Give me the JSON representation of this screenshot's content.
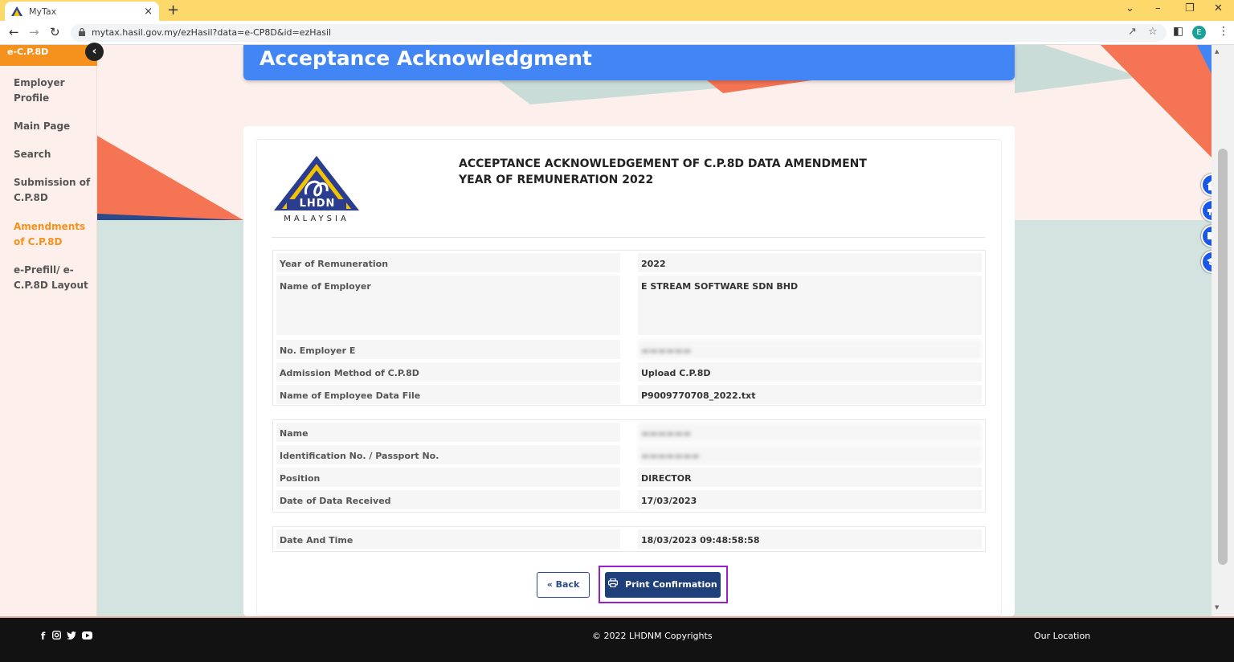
{
  "browser": {
    "tab_title": "MyTax",
    "tab_close": "×",
    "new_tab": "+",
    "url": "mytax.hasil.gov.my/ezHasil?data=e-CP8D&id=ezHasil",
    "profile_initial": "E"
  },
  "sidebar": {
    "header": "e-C.P.8D",
    "items": [
      {
        "label": "Employer Profile",
        "active": false
      },
      {
        "label": "Main Page",
        "active": false
      },
      {
        "label": "Search",
        "active": false
      },
      {
        "label": "Submission of C.P.8D",
        "active": false
      },
      {
        "label": "Amendments of C.P.8D",
        "active": true
      },
      {
        "label": "e-Prefill/ e-C.P.8D Layout",
        "active": false
      }
    ]
  },
  "banner": {
    "title": "Acceptance Acknowledgment"
  },
  "logo": {
    "name": "LHDN",
    "country": "MALAYSIA"
  },
  "document": {
    "title_line1": "ACCEPTANCE ACKNOWLEDGEMENT OF C.P.8D DATA AMENDMENT",
    "title_line2": "YEAR OF REMUNERATION 2022"
  },
  "employer_section": [
    {
      "label": "Year of Remuneration",
      "value": "2022"
    },
    {
      "label": "Name of Employer",
      "value": "E STREAM SOFTWARE SDN BHD"
    },
    {
      "label": "No. Employer E",
      "value": "",
      "redacted": true
    },
    {
      "label": "Admission Method of C.P.8D",
      "value": "Upload C.P.8D"
    },
    {
      "label": "Name of Employee Data File",
      "value": "P9009770708_2022.txt"
    }
  ],
  "submitter_section": [
    {
      "label": "Name",
      "value": "",
      "redacted": true
    },
    {
      "label": "Identification No. / Passport No.",
      "value": "",
      "redacted": true
    },
    {
      "label": "Position",
      "value": "DIRECTOR"
    },
    {
      "label": "Date of Data Received",
      "value": "17/03/2023"
    }
  ],
  "timestamp_section": [
    {
      "label": "Date And Time",
      "value": "18/03/2023 09:48:58:58"
    }
  ],
  "buttons": {
    "back": "« Back",
    "print": "Print Confirmation"
  },
  "footer": {
    "copyright": "© 2022 LHDNM Copyrights",
    "our_location": "Our Location"
  },
  "colors": {
    "accent_orange": "#f5921e",
    "banner_blue": "#4285f4",
    "print_button": "#1f3f7a",
    "highlight": "#9b1fcf"
  }
}
